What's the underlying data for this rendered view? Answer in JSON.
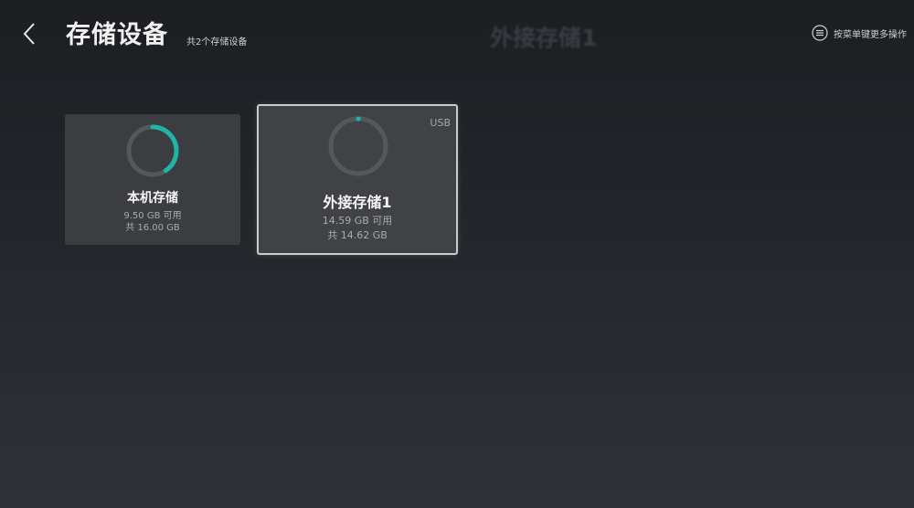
{
  "header": {
    "title": "存储设备",
    "subtitle": "共2个存储设备",
    "ghost_title": "外接存储1",
    "hint": "按菜单键更多操作"
  },
  "devices": [
    {
      "name": "本机存储",
      "available": "9.50 GB 可用",
      "total": "共 16.00 GB",
      "used_fraction": 0.406
    },
    {
      "name": "外接存储1",
      "available": "14.59 GB 可用",
      "total": "共 14.62 GB",
      "badge": "USB",
      "used_fraction": 0.002
    }
  ],
  "colors": {
    "accent": "#1fb5a6",
    "ring_track": "#55585b",
    "focus_border": "#c9cbcd"
  },
  "icons": {
    "back": "chevron-left-icon",
    "menu": "menu-icon"
  }
}
